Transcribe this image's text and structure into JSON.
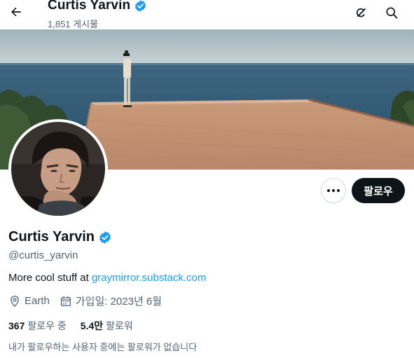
{
  "header": {
    "title": "Curtis Yarvin",
    "post_count": "1,851 게시물",
    "icons": {
      "back": "arrow-left-icon",
      "grok": "grok-icon",
      "search": "search-icon"
    }
  },
  "profile": {
    "display_name": "Curtis Yarvin",
    "verified": true,
    "handle": "@curtis_yarvin",
    "bio_text": "More cool stuff at ",
    "bio_link": "graymirror.substack.com",
    "location": "Earth",
    "joined": "가입일: 2023년 6월",
    "following_count": "367",
    "following_label": "팔로우 중",
    "followers_count": "5.4만",
    "followers_label": "팔로워",
    "followed_by_note": "내가 팔로우하는 사용자 중에는 팔로워가 없습니다"
  },
  "actions": {
    "more_icon": "more-dots-icon",
    "follow_label": "팔로우"
  },
  "colors": {
    "accent": "#1d9bf0",
    "verified": "#1d9bf0",
    "text_primary": "#0f1419",
    "text_secondary": "#536471",
    "follow_button": "#0f1419"
  }
}
